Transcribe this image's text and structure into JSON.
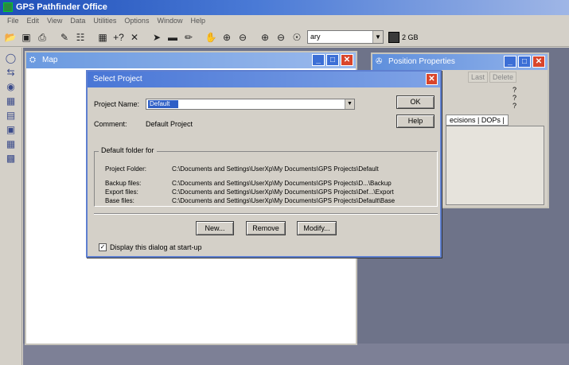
{
  "app": {
    "title": "GPS Pathfinder Office",
    "menu": [
      "File",
      "Edit",
      "View",
      "Data",
      "Utilities",
      "Options",
      "Window",
      "Help"
    ],
    "toolbar": {
      "combo_value": "ary",
      "memory_label": "2 GB"
    }
  },
  "map_window": {
    "title": "Map"
  },
  "position_window": {
    "title": "Position Properties",
    "buttons": [
      "Last",
      "Delete"
    ],
    "question_marks": [
      "?",
      "?",
      "?"
    ],
    "tab_label": "ecisions | DOPs |"
  },
  "dialog": {
    "title": "Select Project",
    "project_name_label": "Project Name:",
    "project_name_value": "Default",
    "comment_label": "Comment:",
    "comment_value": "Default Project",
    "ok_label": "OK",
    "help_label": "Help",
    "group_caption": "Default folder for",
    "folders": [
      {
        "label": "Project Folder:",
        "path": "C:\\Documents and Settings\\UserXp\\My Documents\\GPS Projects\\Default"
      },
      {
        "label": "Backup files:",
        "path": "C:\\Documents and Settings\\UserXp\\My Documents\\GPS Projects\\D...\\Backup"
      },
      {
        "label": "Export files:",
        "path": "C:\\Documents and Settings\\UserXp\\My Documents\\GPS Projects\\Def...\\Export"
      },
      {
        "label": "Base files:",
        "path": "C:\\Documents and Settings\\UserXp\\My Documents\\GPS Projects\\Default\\Base"
      }
    ],
    "new_label": "New...",
    "remove_label": "Remove",
    "modify_label": "Modify...",
    "startup_checkbox_label": "Display this dialog at start-up",
    "startup_checked": true
  },
  "icons": {
    "toolbar": [
      "open-folder-icon",
      "save-icon",
      "print-icon",
      "data-file-icon",
      "import-icon",
      "layers-icon",
      "help-cursor-icon",
      "cut-icon",
      "select-arrow-icon",
      "measure-icon",
      "pencil-icon",
      "pan-icon",
      "zoom-in-icon",
      "zoom-out-icon",
      "zoom-in-alt-icon",
      "zoom-out-alt-icon",
      "globe-icon"
    ],
    "left": [
      "satellite-icon",
      "data-transfer-icon",
      "gps-icon",
      "map-icon",
      "chart-icon",
      "camera-icon",
      "grid-icon",
      "photo-icon"
    ]
  }
}
